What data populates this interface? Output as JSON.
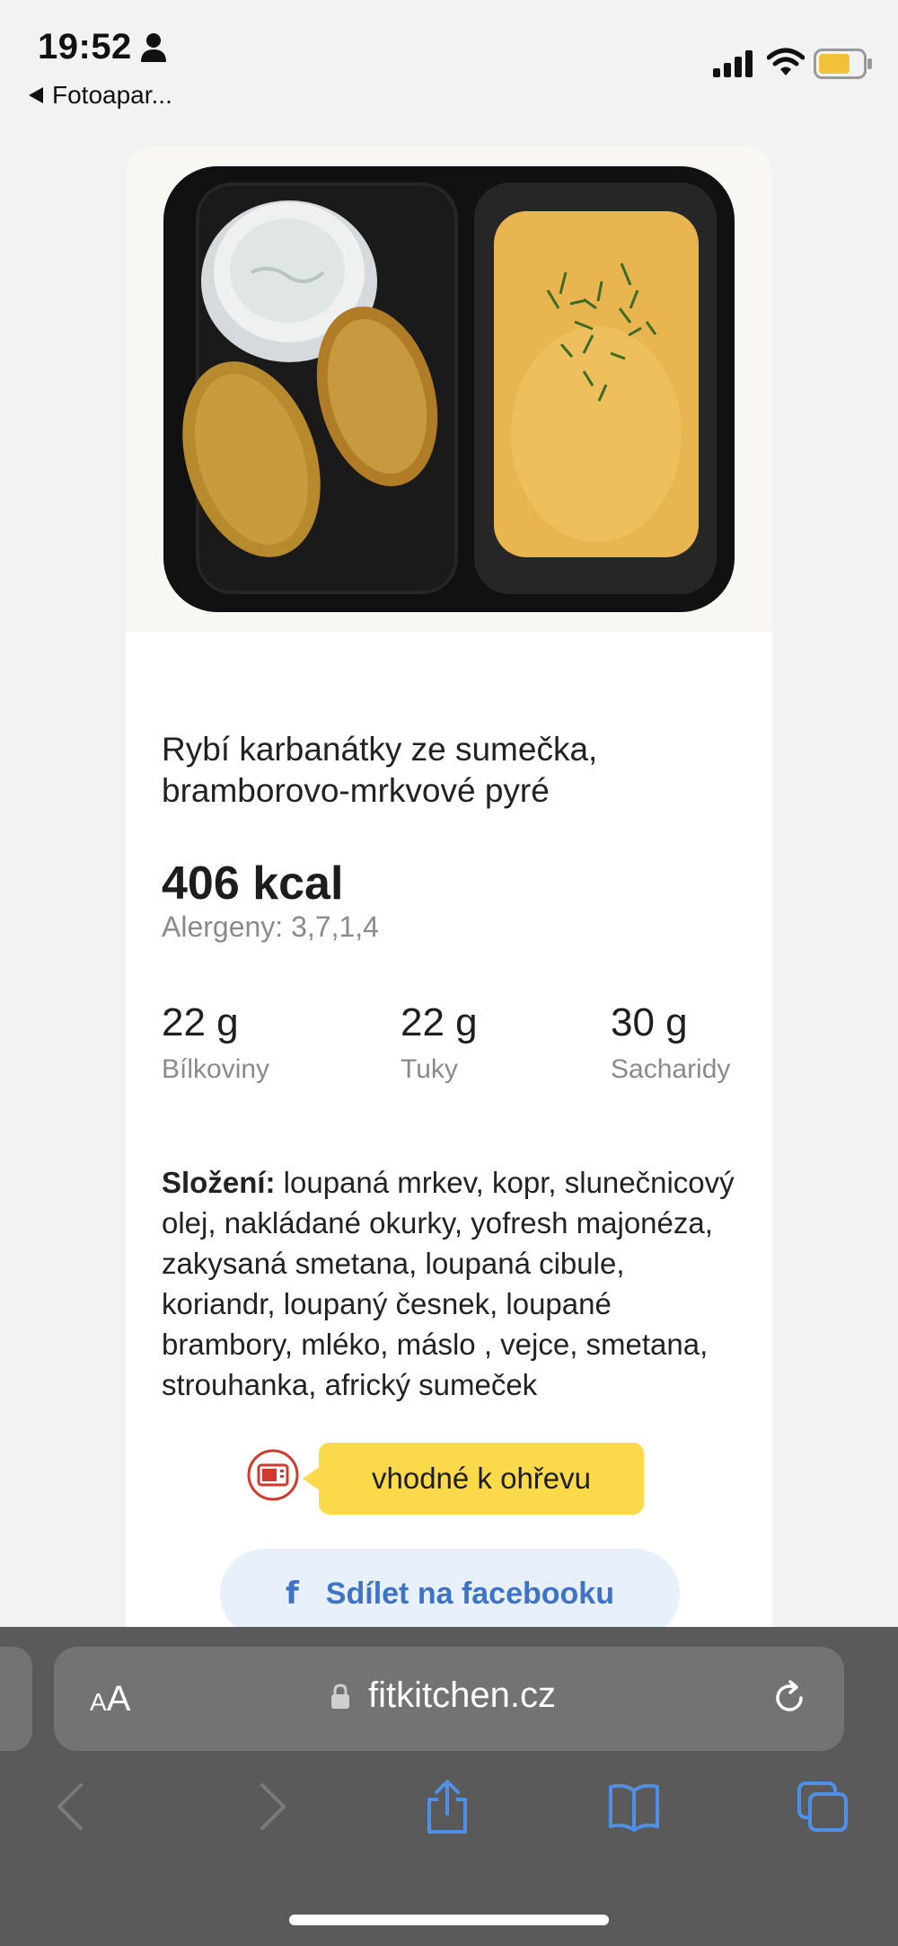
{
  "status_bar": {
    "time": "19:52",
    "back_app": "Fotoapar..."
  },
  "product": {
    "title": "Rybí karbanátky ze sumečka, bramborovo-mrkvové pyré",
    "kcal": "406 kcal",
    "allergens": "Alergeny: 3,7,1,4",
    "macros": [
      {
        "value": "22 g",
        "label": "Bílkoviny"
      },
      {
        "value": "22 g",
        "label": "Tuky"
      },
      {
        "value": "30 g",
        "label": "Sacharidy"
      }
    ],
    "ingredients_label": "Složení:",
    "ingredients_text": " loupaná mrkev, kopr, slunečnicový olej, nakládané okurky, yofresh majonéza, zakysaná smetana, loupaná cibule, koriandr, loupaný česnek, loupané brambory, mléko, máslo , vejce, smetana, strouhanka, africký sumeček",
    "heat_badge": "vhodné k ohřevu",
    "share_button": "Sdílet na facebooku",
    "share_icon_glyph": "f"
  },
  "browser": {
    "aa_small": "A",
    "aa_large": "A",
    "url": "fitkitchen.cz"
  },
  "colors": {
    "badge": "#fad94a",
    "facebook": "#3d74c7",
    "chrome": "#5a5a5a",
    "toolbar_icons": "#4f8fe6"
  },
  "icons": [
    "person-icon",
    "signal-icon",
    "wifi-icon",
    "battery-icon",
    "microwave-icon",
    "facebook-icon",
    "lock-icon",
    "reload-icon",
    "back-icon",
    "forward-icon",
    "share-icon",
    "bookmarks-icon",
    "tabs-icon"
  ]
}
